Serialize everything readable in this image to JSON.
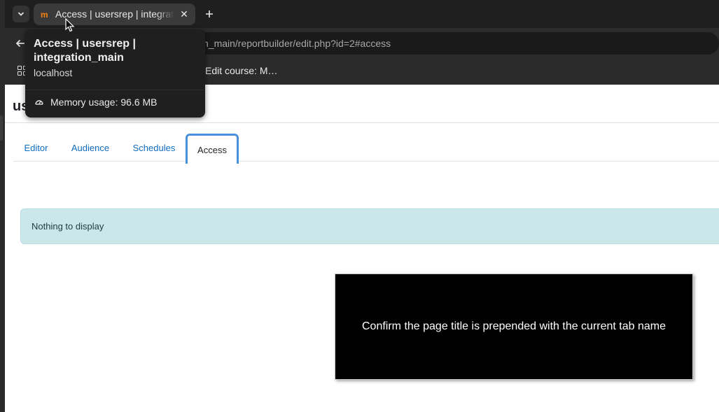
{
  "browser": {
    "active_tab": {
      "title": "Access | usersrep | integration_main",
      "favicon": "moodle-icon"
    },
    "url": "n_main/reportbuilder/edit.php?id=2#access",
    "bookmarks": [
      {
        "label": "Edit course: M…"
      }
    ],
    "tooltip": {
      "title": "Access | usersrep | integration_main",
      "host": "localhost",
      "memory": "Memory usage: 96.6 MB"
    }
  },
  "page": {
    "heading": "us",
    "tabs": [
      {
        "label": "Editor"
      },
      {
        "label": "Audience"
      },
      {
        "label": "Schedules"
      },
      {
        "label": "Access",
        "active": true
      }
    ],
    "alert": "Nothing to display",
    "overlay_message": "Confirm the page title is prepended with the current tab name"
  },
  "colors": {
    "link": "#0f6cbf",
    "alert_bg": "#cce7ea",
    "active_tab_border": "#4a8fd9",
    "moodle_orange": "#f98012"
  }
}
